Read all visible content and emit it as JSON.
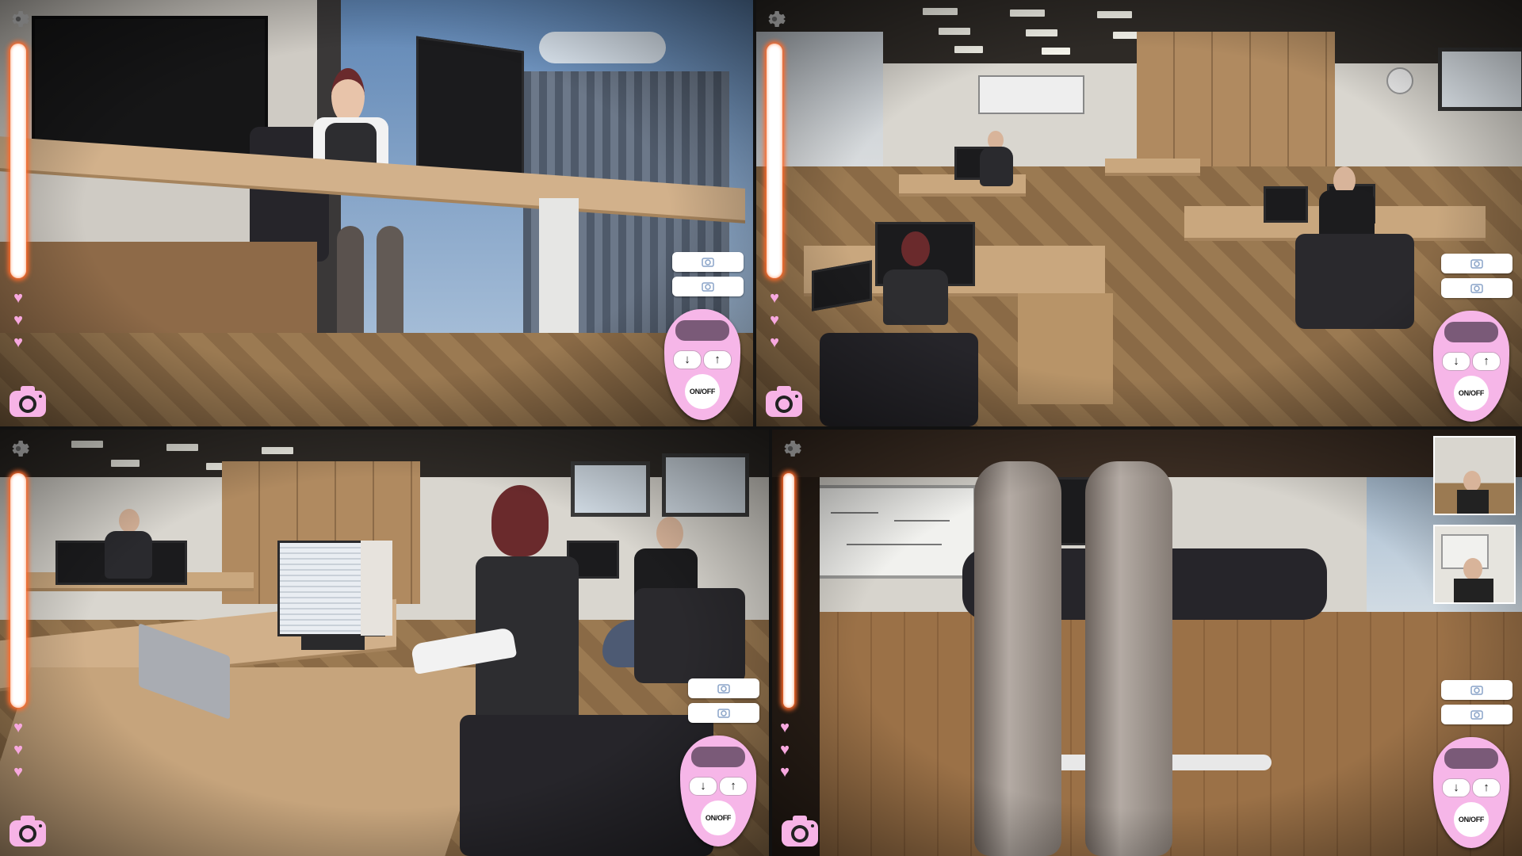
{
  "hud": {
    "remote_down_symbol": "↓",
    "remote_up_symbol": "↑",
    "remote_onoff_label": "ON/OFF",
    "hearts_count": 3,
    "icons": [
      "gear-icon",
      "heart-icon",
      "camera-icon",
      "small-camera-icon"
    ],
    "colors": {
      "meter_glow": "#ff6a2a",
      "heart": "#f7a8df",
      "remote_body": "#f6b6e8",
      "remote_display": "#7a5a78"
    }
  },
  "panels": [
    {
      "id": "top-left",
      "scene": "office-window-desk"
    },
    {
      "id": "top-right",
      "scene": "open-office-overview"
    },
    {
      "id": "bottom-left",
      "scene": "office-typing-closeup"
    },
    {
      "id": "bottom-right",
      "scene": "under-desk-view",
      "thumbnails": 2
    }
  ]
}
